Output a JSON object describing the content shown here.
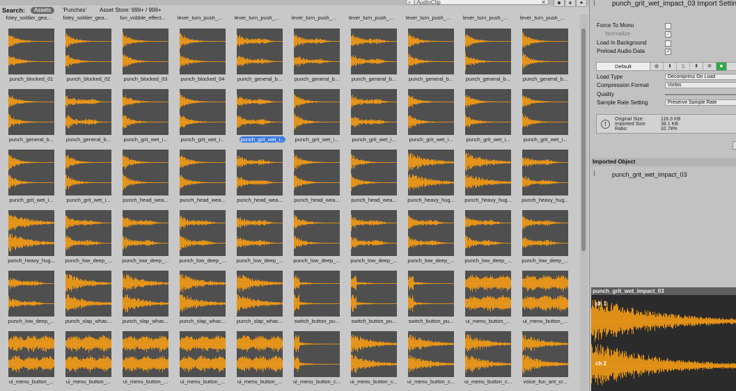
{
  "project": {
    "search_text": "t:AudioClip",
    "search_label": "Search:",
    "scope_assets": "Assets",
    "scope_punches": "'Punches'",
    "scope_store": "Asset Store: 999+ / 999+",
    "icons": [
      "search-icon",
      "clear-search-icon",
      "filter-type-icon",
      "filter-label-icon",
      "favorite-star-icon"
    ],
    "top_labels": [
      "foley_soldier_gea...",
      "foley_soldier_gea...",
      "fun_vobble_effect...",
      "lever_turn_push_...",
      "lever_turn_push_...",
      "lever_turn_push_...",
      "lever_turn_push_...",
      "lever_turn_push_...",
      "lever_turn_push_...",
      "lever_turn_push_..."
    ],
    "grid": [
      [
        {
          "label": "punch_blocked_01",
          "w": 1
        },
        {
          "label": "punch_blocked_02",
          "w": 1
        },
        {
          "label": "punch_blocked_03",
          "w": 1
        },
        {
          "label": "punch_blocked_04",
          "w": 1
        },
        {
          "label": "punch_general_b...",
          "w": 2
        },
        {
          "label": "punch_general_b...",
          "w": 2
        },
        {
          "label": "punch_general_b...",
          "w": 2
        },
        {
          "label": "punch_general_b...",
          "w": 1
        },
        {
          "label": "punch_general_b...",
          "w": 1
        },
        {
          "label": "punch_general_b...",
          "w": 1
        }
      ],
      [
        {
          "label": "punch_general_b...",
          "w": 1
        },
        {
          "label": "punch_general_b...",
          "w": 2
        },
        {
          "label": "punch_grit_wet_i...",
          "w": 1
        },
        {
          "label": "punch_grit_wet_i...",
          "w": 1
        },
        {
          "label": "punch_grit_wet_i...",
          "w": 2,
          "selected": true
        },
        {
          "label": "punch_grit_wet_i...",
          "w": 1
        },
        {
          "label": "punch_grit_wet_i...",
          "w": 2
        },
        {
          "label": "punch_grit_wet_i...",
          "w": 1
        },
        {
          "label": "punch_grit_wet_i...",
          "w": 1
        },
        {
          "label": "punch_grit_wet_i...",
          "w": 1
        }
      ],
      [
        {
          "label": "punch_grit_wet_i...",
          "w": 1
        },
        {
          "label": "punch_grit_wet_i...",
          "w": 1
        },
        {
          "label": "punch_head_wea...",
          "w": 1
        },
        {
          "label": "punch_head_wea...",
          "w": 1
        },
        {
          "label": "punch_head_wea...",
          "w": 2
        },
        {
          "label": "punch_head_wea...",
          "w": 1
        },
        {
          "label": "punch_head_wea...",
          "w": 1
        },
        {
          "label": "punch_heavy_hug...",
          "w": 3
        },
        {
          "label": "punch_heavy_hug...",
          "w": 3
        },
        {
          "label": "punch_heavy_hug...",
          "w": 2
        }
      ],
      [
        {
          "label": "punch_heavy_hug...",
          "w": 3
        },
        {
          "label": "punch_low_deep_...",
          "w": 2
        },
        {
          "label": "punch_low_deep_...",
          "w": 2
        },
        {
          "label": "punch_low_deep_...",
          "w": 2
        },
        {
          "label": "punch_low_deep_...",
          "w": 2
        },
        {
          "label": "punch_low_deep_...",
          "w": 1
        },
        {
          "label": "punch_low_deep_...",
          "w": 2
        },
        {
          "label": "punch_low_deep_...",
          "w": 2
        },
        {
          "label": "punch_low_deep_...",
          "w": 2
        },
        {
          "label": "punch_low_deep_...",
          "w": 2
        }
      ],
      [
        {
          "label": "punch_low_deep_...",
          "w": 2
        },
        {
          "label": "punch_slap_whac...",
          "w": 3
        },
        {
          "label": "punch_slap_whac...",
          "w": 3
        },
        {
          "label": "punch_slap_whac...",
          "w": 3
        },
        {
          "label": "punch_slap_whac...",
          "w": 3
        },
        {
          "label": "switch_button_pu...",
          "w": 4
        },
        {
          "label": "switch_button_pu...",
          "w": 4
        },
        {
          "label": "switch_button_pu...",
          "w": 4
        },
        {
          "label": "ui_menu_button_...",
          "w": 5
        },
        {
          "label": "ui_menu_button_...",
          "w": 5
        }
      ],
      [
        {
          "label": "ui_menu_button_...",
          "w": 5
        },
        {
          "label": "ui_menu_button_...",
          "w": 5
        },
        {
          "label": "ui_menu_button_...",
          "w": 5
        },
        {
          "label": "ui_menu_button_...",
          "w": 5
        },
        {
          "label": "ui_menu_button_...",
          "w": 5
        },
        {
          "label": "ui_menu_button_c...",
          "w": 4
        },
        {
          "label": "ui_menu_button_c...",
          "w": 3
        },
        {
          "label": "ui_menu_button_c...",
          "w": 3
        },
        {
          "label": "ui_menu_button_c...",
          "w": 3
        },
        {
          "label": "voice_fun_ant_cr...",
          "w": 3
        }
      ]
    ]
  },
  "inspector": {
    "title": "punch_grit_wet_impact_03 Import Settin",
    "force_to_mono": {
      "label": "Force To Mono",
      "checked": false
    },
    "normalize": {
      "label": "Normalize",
      "checked": true
    },
    "load_in_background": {
      "label": "Load In Background",
      "checked": false
    },
    "preload_audio_data": {
      "label": "Preload Audio Data",
      "checked": true
    },
    "default_tab": "Default",
    "platform_icons": [
      "globe-icon",
      "download-icon",
      "mobile-icon",
      "arrow-down-icon",
      "settings-icon",
      "android-icon"
    ],
    "load_type": {
      "label": "Load Type",
      "value": "Decompress On Load"
    },
    "compression_format": {
      "label": "Compression Format",
      "value": "Vorbis"
    },
    "quality": {
      "label": "Quality"
    },
    "sample_rate": {
      "label": "Sample Rate Setting",
      "value": "Preserve Sample Rate"
    },
    "info": {
      "original_label": "Original Size:",
      "original": "116.3 KB",
      "imported_label": "Imported Size:",
      "imported": "38.1 KB",
      "ratio_label": "Ratio:",
      "ratio": "32.78%"
    },
    "imported_header": "Imported Object",
    "imported_name": "punch_grit_wet_impact_03"
  },
  "preview": {
    "title": "punch_grit_wet_impact_03",
    "ch1": "ch 1",
    "ch2": "ch 2"
  },
  "colors": {
    "waveform": "#f39b16",
    "thumb_bg": "#4f4f4f",
    "selection": "#3d7be0"
  }
}
